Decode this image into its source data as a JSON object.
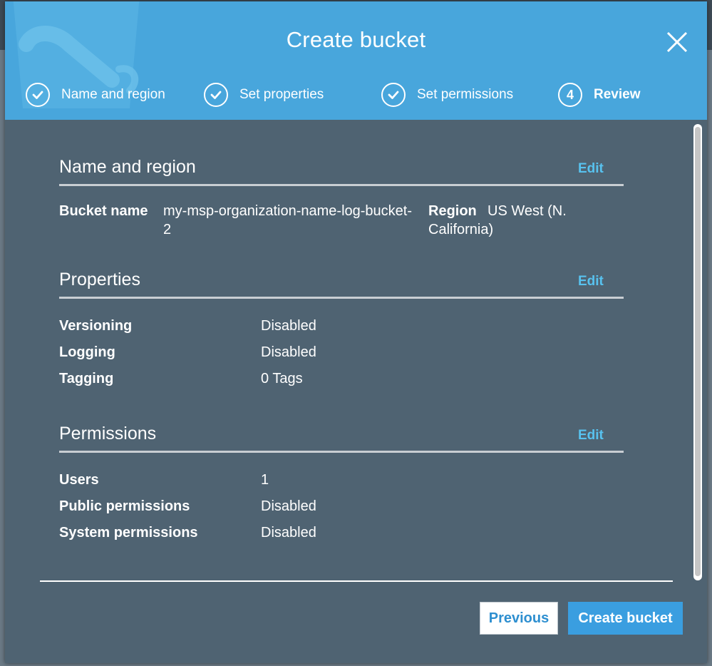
{
  "modal": {
    "title": "Create bucket",
    "steps": [
      {
        "label": "Name and region",
        "state": "done"
      },
      {
        "label": "Set properties",
        "state": "done"
      },
      {
        "label": "Set permissions",
        "state": "done"
      },
      {
        "label": "Review",
        "number": "4",
        "state": "current"
      }
    ]
  },
  "name_region": {
    "title": "Name and region",
    "edit": "Edit",
    "bucket_label": "Bucket name",
    "bucket_value": "my-msp-organization-name-log-bucket-2",
    "region_label": "Region",
    "region_value_1": "US West (N.",
    "region_value_2": "California)"
  },
  "properties": {
    "title": "Properties",
    "edit": "Edit",
    "rows": [
      {
        "label": "Versioning",
        "value": "Disabled"
      },
      {
        "label": "Logging",
        "value": "Disabled"
      },
      {
        "label": "Tagging",
        "value": "0 Tags"
      }
    ]
  },
  "permissions": {
    "title": "Permissions",
    "edit": "Edit",
    "rows": [
      {
        "label": "Users",
        "value": "1"
      },
      {
        "label": "Public permissions",
        "value": "Disabled"
      },
      {
        "label": "System permissions",
        "value": "Disabled"
      }
    ]
  },
  "footer": {
    "previous": "Previous",
    "create": "Create bucket"
  },
  "colors": {
    "header": "#48a6dc",
    "body": "#4f6372",
    "link": "#58c2ef",
    "primary_button": "#3a9ee0"
  }
}
